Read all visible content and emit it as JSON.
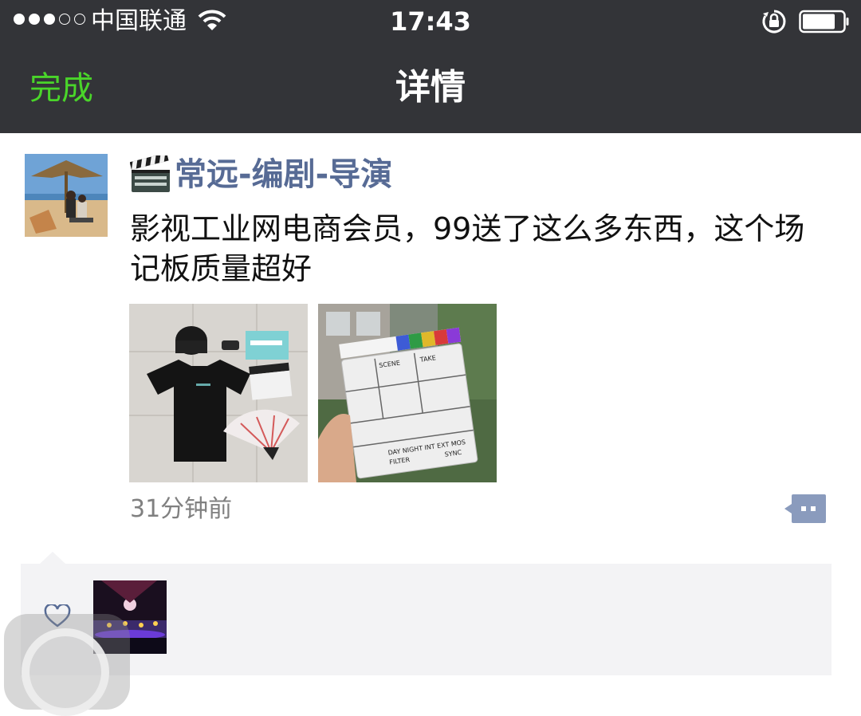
{
  "status_bar": {
    "carrier": "中国联通",
    "time": "17:43",
    "signal_icon": "signal-dots-icon",
    "wifi_icon": "wifi-icon",
    "orientation_lock_icon": "orientation-lock-icon",
    "battery_icon": "battery-icon"
  },
  "nav": {
    "done_label": "完成",
    "title": "详情",
    "done_color": "#4ad52a",
    "bar_color": "#333438"
  },
  "post": {
    "username": "常远-编剧-导演",
    "username_prefix_icon": "clapperboard-emoji-icon",
    "username_color": "#576b95",
    "text": "影视工业网电商会员，99送了这么多东西，这个场记板质量超好",
    "photos": [
      {
        "name": "tshirt-cap-fan-items-photo",
        "clapper_labels": []
      },
      {
        "name": "clapperboard-photo",
        "clapper_labels": [
          "SCENE",
          "TAKE",
          "DAY NIGHT INT EXT MOS",
          "FILTER",
          "SYNC"
        ]
      }
    ],
    "time_ago": "31分钟前",
    "comment_icon": "comment-dots-icon"
  },
  "likes": {
    "heart_icon": "heart-outline-icon",
    "background": "#f3f3f5"
  }
}
